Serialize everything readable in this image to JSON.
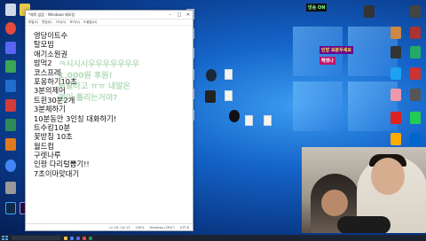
{
  "notepad": {
    "title": "*제목 없음 - Windows 메모장",
    "menu": [
      "파일(F)",
      "편집(E)",
      "서식(O)",
      "보기(V)",
      "도움말(H)"
    ],
    "lines": [
      "영당이트수",
      "탈모빔",
      "애기소원권",
      "밥먹2",
      "코스프레",
      "포옹하기10초",
      "3분의제어",
      "트윈30분2개",
      "3분체하기",
      "10분동안 3인칭 대화하기!",
      "트수킹10분",
      "꽃받침 10초",
      "월드컵",
      "구렛나루",
      "인팡 다리털뽑기!!",
      "7초이마맞대기"
    ],
    "status": [
      "Ln 16, Col 13",
      "100%",
      "Windows (CRLF)",
      "UTF-8"
    ]
  },
  "overlay_chat": [
    "ㅋ시시시우우우우우우우",
    "1,000원 후원!",
    "ㅌ괄라고 ㅠㅠ 내말은",
    "렴이 틀리는거야?"
  ],
  "stream_badges": [
    "방송 ON",
    "인방 보분우세요",
    "헤엣나"
  ],
  "colors": {
    "accent": "#1463c8",
    "taskbar": "#1b2332"
  }
}
